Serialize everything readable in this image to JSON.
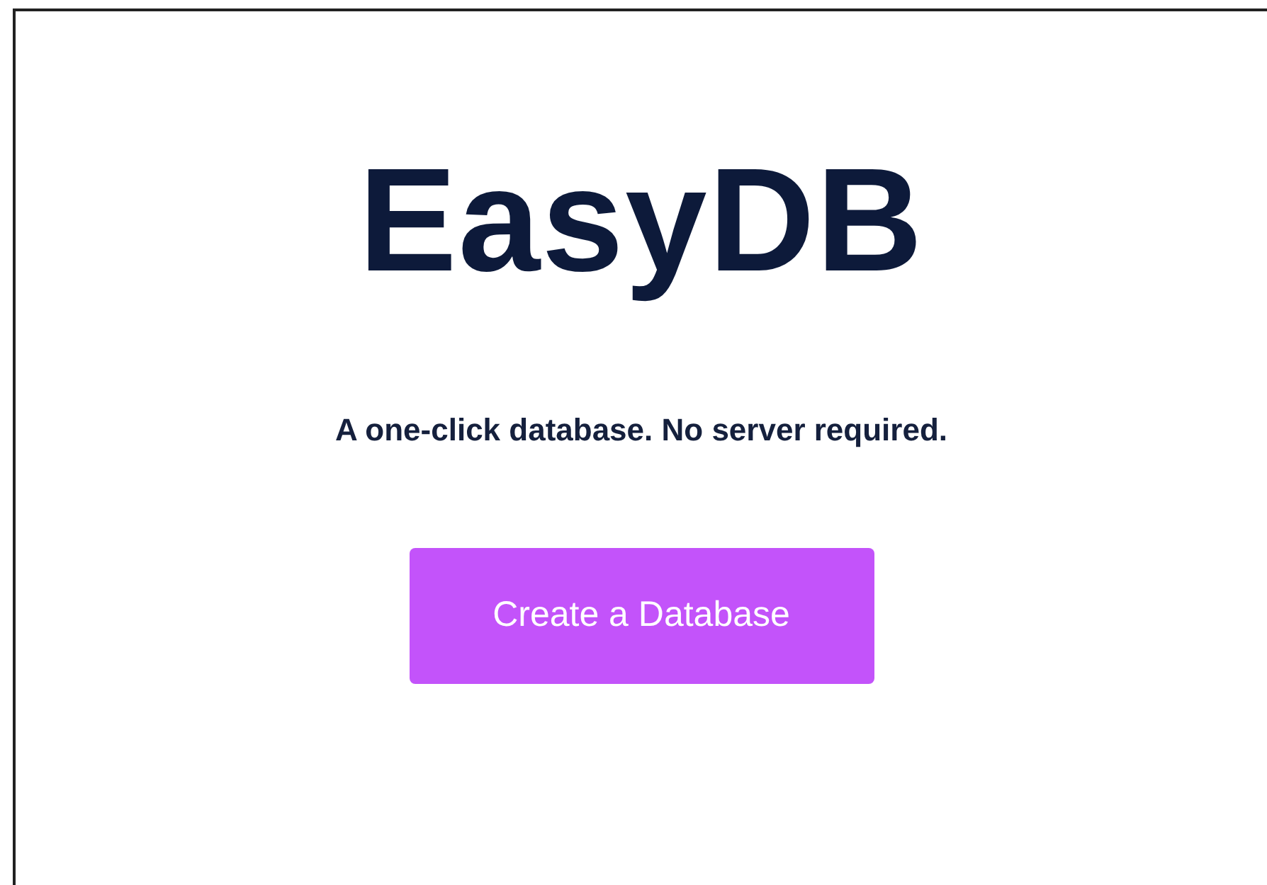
{
  "title": "EasyDB",
  "tagline": "A one-click database. No server required.",
  "button": {
    "label": "Create a Database"
  }
}
